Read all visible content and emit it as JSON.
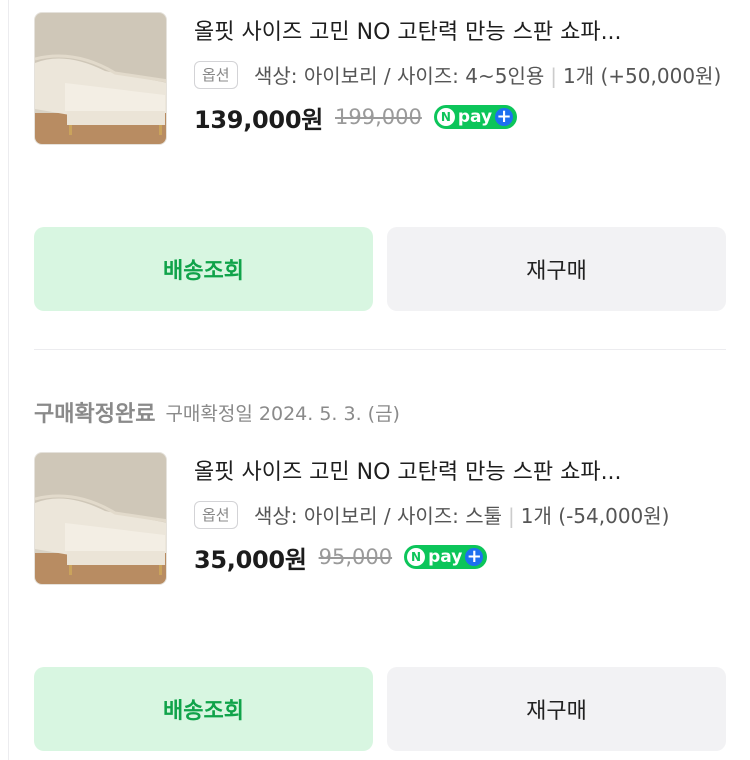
{
  "orders": [
    {
      "title": "올핏 사이즈 고민 NO 고탄력 만능 스판 쇼파...",
      "option_badge": "옵션",
      "option_text": "색상: 아이보리 / 사이즈: 4~5인용",
      "quantity_text": "1개 (+50,000원)",
      "price": "139,000원",
      "original_price": "199,000",
      "npay_label": "pay",
      "track_button": "배송조회",
      "rebuy_button": "재구매"
    },
    {
      "title": "올핏 사이즈 고민 NO 고탄력 만능 스판 쇼파...",
      "option_badge": "옵션",
      "option_text": "색상: 아이보리 / 사이즈: 스툴",
      "quantity_text": "1개 (-54,000원)",
      "price": "35,000원",
      "original_price": "95,000",
      "npay_label": "pay",
      "track_button": "배송조회",
      "rebuy_button": "재구매"
    }
  ],
  "status": {
    "title": "구매확정완료",
    "date": "구매확정일 2024. 5. 3. (금)"
  },
  "npay_icons": {
    "n": "N",
    "plus": "+"
  },
  "colors": {
    "track_bg": "#d8f6e1",
    "track_text": "#10a34a",
    "rebuy_bg": "#f2f2f4",
    "npay_green": "#0cc55a",
    "npay_plus": "#1d70f0"
  },
  "icons": [
    "product-thumbnail",
    "npay-plus-icon"
  ]
}
